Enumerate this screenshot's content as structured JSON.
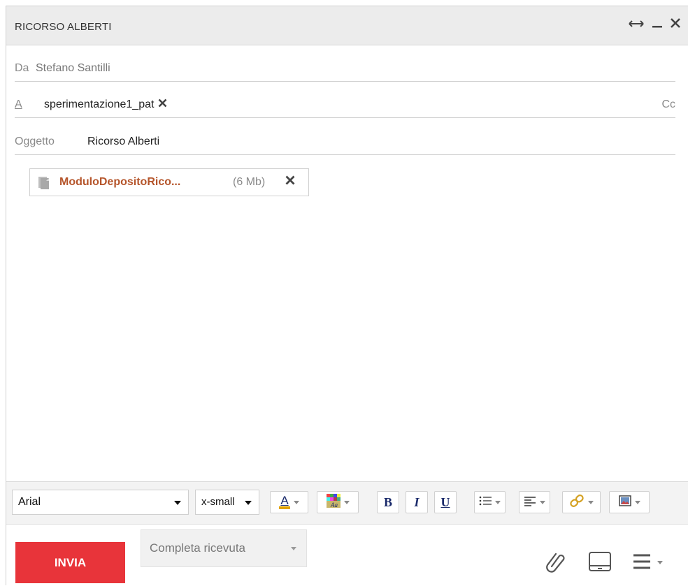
{
  "window": {
    "title": "RICORSO ALBERTI",
    "icons": [
      "resize-horizontal-icon",
      "minimize-icon",
      "close-icon"
    ]
  },
  "from": {
    "label": "Da",
    "value": "Stefano Santilli"
  },
  "to": {
    "label": "A",
    "recipient": "sperimentazione1_pat",
    "cc_label": "Cc"
  },
  "subject": {
    "label": "Oggetto",
    "value": "Ricorso Alberti"
  },
  "attachment": {
    "name": "ModuloDepositoRico...",
    "size": "(6 Mb)"
  },
  "toolbar": {
    "font": "Arial",
    "size": "x-small",
    "buttons": [
      "text-color-icon",
      "background-color-icon",
      "bold-icon",
      "italic-icon",
      "underline-icon",
      "bullet-list-icon",
      "align-icon",
      "link-icon",
      "insert-image-icon"
    ],
    "bold_glyph": "B",
    "italic_glyph": "I",
    "underline_glyph": "U",
    "text_color_glyph": "A"
  },
  "footer": {
    "send_label": "INVIA",
    "receipt_label": "Completa ricevuta",
    "icons": [
      "paperclip-icon",
      "tablet-icon",
      "menu-icon"
    ]
  },
  "colors": {
    "send": "#e8343a",
    "attachment_name": "#b5552b",
    "titlebar": "#ececec"
  }
}
